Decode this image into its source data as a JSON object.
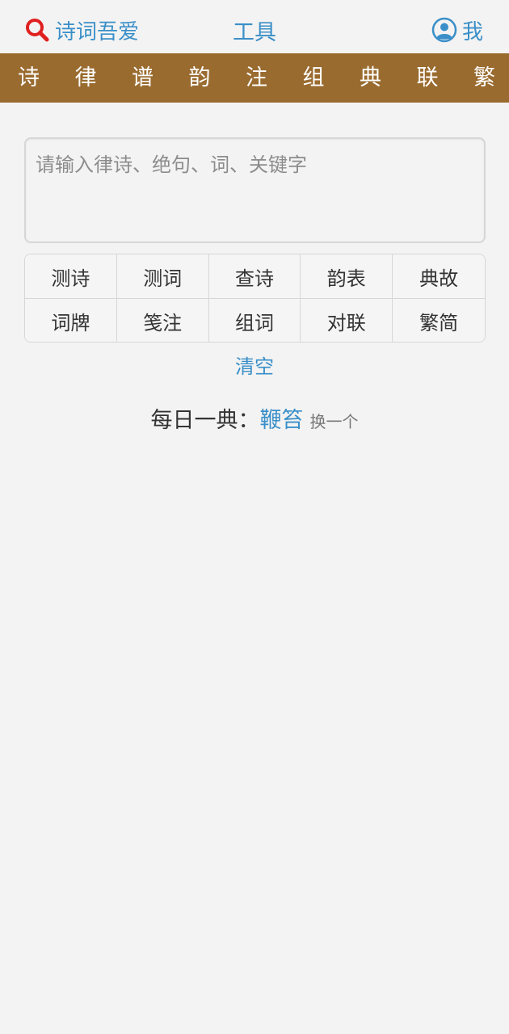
{
  "header": {
    "brand": "诗词吾爱",
    "tools": "工具",
    "me": "我"
  },
  "nav": [
    "诗",
    "律",
    "谱",
    "韵",
    "注",
    "组",
    "典",
    "联",
    "繁"
  ],
  "search": {
    "placeholder": "请输入律诗、绝句、词、关键字",
    "value": ""
  },
  "buttons": [
    "测诗",
    "测词",
    "查诗",
    "韵表",
    "典故",
    "词牌",
    "笺注",
    "组词",
    "对联",
    "繁简"
  ],
  "clear": "清空",
  "daily": {
    "label": "每日一典：",
    "word": "鞭笞",
    "change": "换一个"
  },
  "colors": {
    "accent": "#3a8fc8",
    "nav_bg": "#9a6b2f",
    "search_icon": "#e02020"
  }
}
